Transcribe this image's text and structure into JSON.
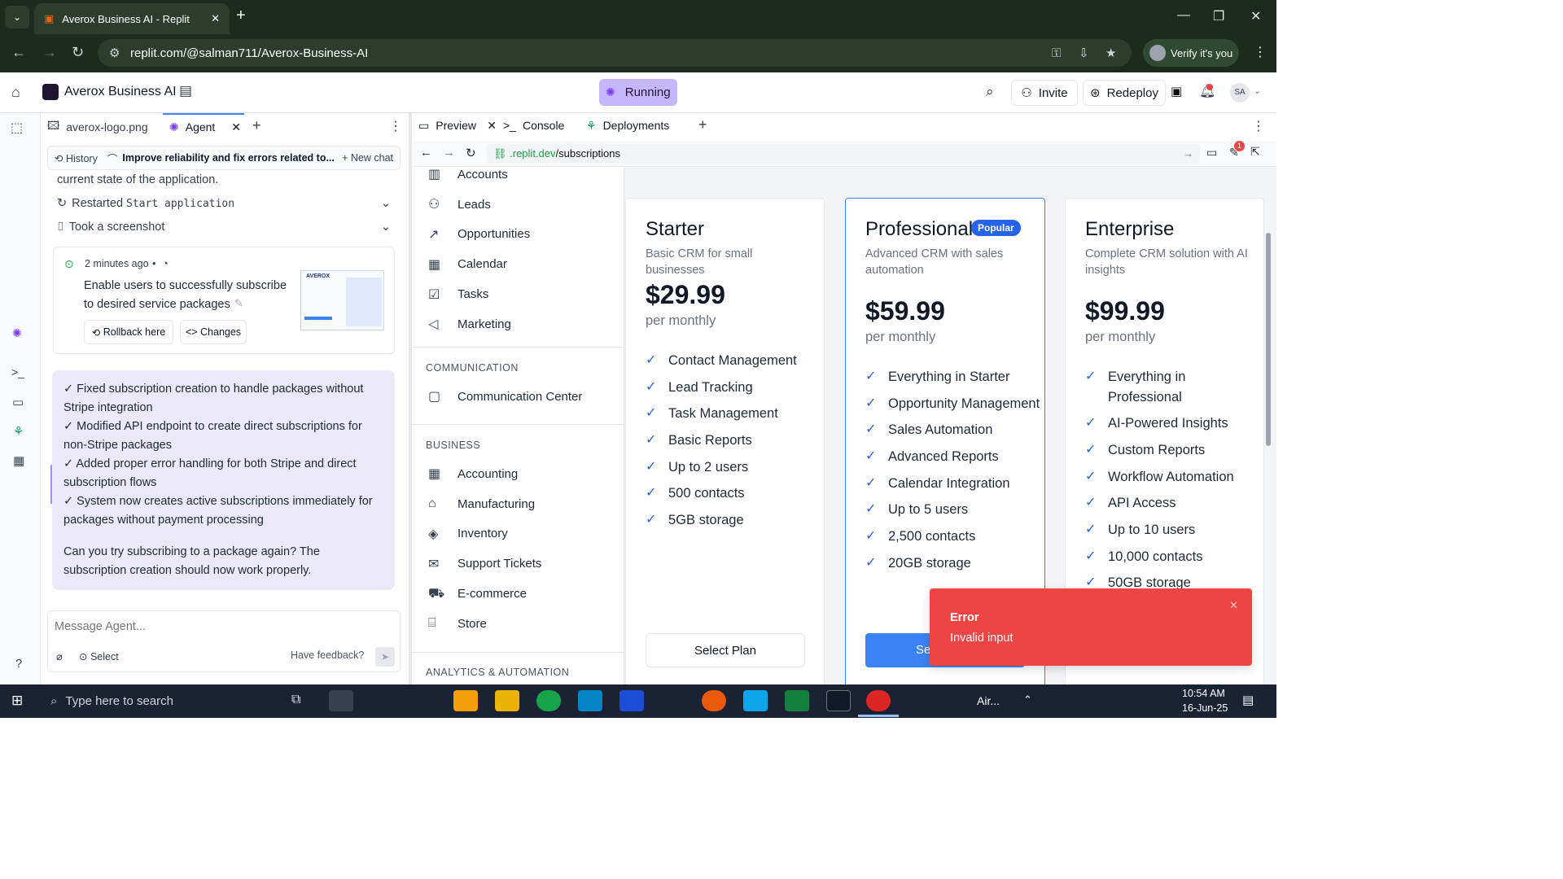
{
  "browser": {
    "tab_title": "Averox Business AI - Replit",
    "url": "replit.com/@salman711/Averox-Business-AI",
    "verify_label": "Verify it's you"
  },
  "replit": {
    "project": "Averox Business AI",
    "status": "Running",
    "invite": "Invite",
    "redeploy": "Redeploy",
    "avatar": "SA"
  },
  "agent_tabs": [
    {
      "label": "averox-logo.png"
    },
    {
      "label": "Agent"
    }
  ],
  "agent_toolbar": {
    "history": "History",
    "thread": "Improve reliability and fix errors related to...",
    "new_chat": "New chat"
  },
  "agent_log": {
    "line0": "current state of the application.",
    "restarted_prefix": "Restarted",
    "restarted_cmd": "Start application",
    "screenshot": "Took a screenshot"
  },
  "checkpoint": {
    "time": "2 minutes ago",
    "bullet": "•",
    "text": "Enable users to successfully subscribe to desired service packages",
    "rollback": "Rollback here",
    "changes": "Changes",
    "thumb_logo": "AVEROX"
  },
  "message": {
    "items": [
      "✓ Fixed subscription creation to handle packages without Stripe integration",
      "✓ Modified API endpoint to create direct subscriptions for non-Stripe packages",
      "✓ Added proper error handling for both Stripe and direct subscription flows",
      "✓ System now creates active subscriptions immediately for packages without payment processing"
    ],
    "question": "Can you try subscribing to a package again? The subscription creation should now work properly."
  },
  "composer": {
    "placeholder": "Message Agent...",
    "select": "Select",
    "feedback": "Have feedback?"
  },
  "preview_tabs": [
    {
      "label": "Preview"
    },
    {
      "label": "Console"
    },
    {
      "label": "Deployments"
    }
  ],
  "preview_url": {
    "domain": ".replit.dev",
    "path": "/subscriptions",
    "badge": "1"
  },
  "sidebar": {
    "top_items": [
      "Accounts",
      "Leads",
      "Opportunities",
      "Calendar",
      "Tasks",
      "Marketing"
    ],
    "communication_header": "COMMUNICATION",
    "communication_items": [
      "Communication Center"
    ],
    "business_header": "BUSINESS",
    "business_items": [
      "Accounting",
      "Manufacturing",
      "Inventory",
      "Support Tickets",
      "E-commerce",
      "Store"
    ],
    "analytics_header": "ANALYTICS & AUTOMATION"
  },
  "plans": [
    {
      "name": "Starter",
      "desc": "Basic CRM for small businesses",
      "price": "$29.99",
      "period": "per monthly",
      "features": [
        "Contact Management",
        "Lead Tracking",
        "Task Management",
        "Basic Reports",
        "Up to 2 users",
        "500 contacts",
        "5GB storage"
      ],
      "button": "Select Plan"
    },
    {
      "name": "Professional",
      "badge": "Popular",
      "desc": "Advanced CRM with sales automation",
      "price": "$59.99",
      "period": "per monthly",
      "features": [
        "Everything in Starter",
        "Opportunity Management",
        "Sales Automation",
        "Advanced Reports",
        "Calendar Integration",
        "Up to 5 users",
        "2,500 contacts",
        "20GB storage"
      ],
      "button": "Se"
    },
    {
      "name": "Enterprise",
      "desc": "Complete CRM solution with AI insights",
      "price": "$99.99",
      "period": "per monthly",
      "features": [
        "Everything in Professional",
        "AI-Powered Insights",
        "Custom Reports",
        "Workflow Automation",
        "API Access",
        "Up to 10 users",
        "10,000 contacts",
        "50GB storage"
      ]
    }
  ],
  "toast": {
    "title": "Error",
    "message": "Invalid input"
  },
  "taskbar": {
    "search": "Type here to search",
    "weather": "Air...",
    "time": "10:54 AM",
    "date": "16-Jun-25"
  },
  "colors": {
    "accent": "#2563eb",
    "toast": "#ef4444",
    "running": "#c4b5fd",
    "bubble": "#ece9f6"
  }
}
